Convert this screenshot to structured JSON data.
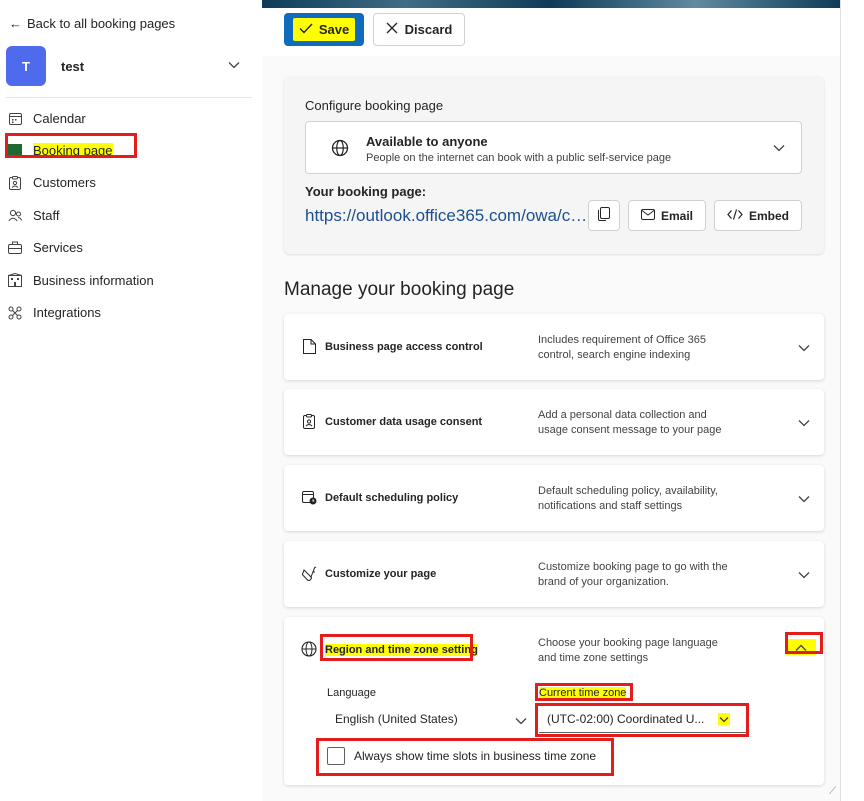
{
  "sidebar": {
    "back_link": "Back to all booking pages",
    "account": {
      "initial": "T",
      "name": "test"
    },
    "items": [
      {
        "label": "Calendar",
        "icon": "calendar-icon",
        "active": false
      },
      {
        "label": "Booking page",
        "icon": "booking-page-icon",
        "active": true
      },
      {
        "label": "Customers",
        "icon": "customers-icon",
        "active": false
      },
      {
        "label": "Staff",
        "icon": "staff-icon",
        "active": false
      },
      {
        "label": "Services",
        "icon": "services-icon",
        "active": false
      },
      {
        "label": "Business information",
        "icon": "business-info-icon",
        "active": false
      },
      {
        "label": "Integrations",
        "icon": "integrations-icon",
        "active": false
      }
    ]
  },
  "toolbar": {
    "save_label": "Save",
    "discard_label": "Discard"
  },
  "config": {
    "title": "Configure booking page",
    "access_title": "Available to anyone",
    "access_subtitle": "People on the internet can book with a public self-service page",
    "your_page_label": "Your booking page:",
    "url": "https://outlook.office365.com/owa/ca...",
    "email_label": "Email",
    "embed_label": "Embed"
  },
  "manage": {
    "title": "Manage your booking page",
    "sections": [
      {
        "title": "Business page access control",
        "desc": "Includes requirement of Office 365 control, search engine indexing",
        "icon": "page-icon"
      },
      {
        "title": "Customer data usage consent",
        "desc": "Add a personal data collection and usage consent message to your page",
        "icon": "clipboard-icon"
      },
      {
        "title": "Default scheduling policy",
        "desc": "Default scheduling policy, availability, notifications and staff settings",
        "icon": "calendar-clock-icon"
      },
      {
        "title": "Customize your page",
        "desc": "Customize booking page to go with the brand of your organization.",
        "icon": "paint-icon"
      }
    ],
    "region": {
      "title": "Region and time zone setting",
      "desc": "Choose your booking page language and time zone settings",
      "language_label": "Language",
      "language_value": "English (United States)",
      "timezone_label": "Current time zone",
      "timezone_value": "(UTC-02:00) Coordinated U...",
      "checkbox_label": "Always show time slots in business time zone"
    }
  },
  "colors": {
    "brand": "#0f6cbd",
    "avatar": "#4f6bed",
    "highlight": "#ffff00",
    "annotation": "#e31c1c"
  }
}
